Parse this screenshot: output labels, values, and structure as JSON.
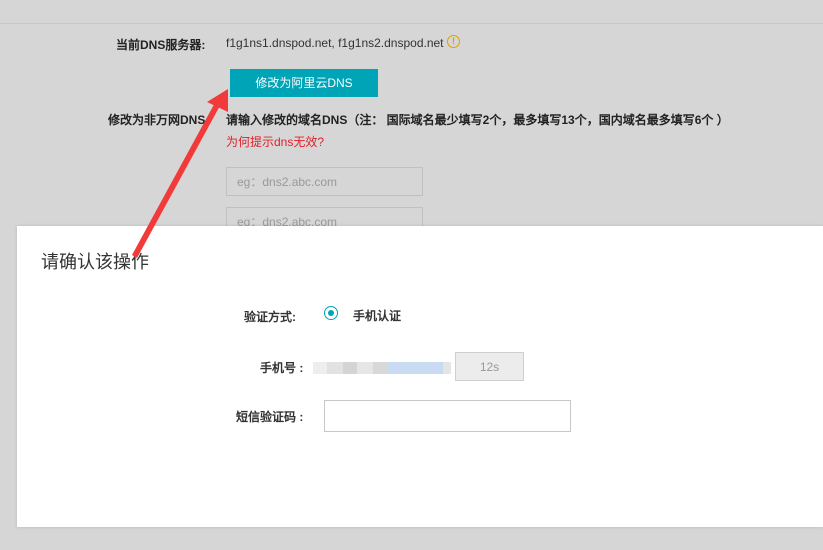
{
  "background_page": {
    "current_dns_label": "当前DNS服务器:",
    "current_dns_value": "f1g1ns1.dnspod.net, f1g1ns2.dnspod.net",
    "change_button_label": "修改为阿里云DNS",
    "non_wanwang_label": "修改为非万网DNS",
    "instruction": "请输入修改的域名DNS（注：  国际域名最少填写2个，最多填写13个，国内域名最多填写6个 ）",
    "hint_link": "为何提示dns无效?",
    "dns_inputs": [
      {
        "placeholder": "eg：dns2.abc.com"
      },
      {
        "placeholder": "eg：dns2.abc.com"
      }
    ],
    "warn_glyph": "!"
  },
  "modal": {
    "title": "请确认该操作",
    "verify_method_label": "验证方式:",
    "verify_method_option": "手机认证",
    "phone_label": "手机号 :",
    "countdown_label": "12s",
    "sms_code_label": "短信验证码 :",
    "sms_code_value": ""
  },
  "colors": {
    "accent": "#00a4b7",
    "link_red": "#e0212c",
    "annotation_arrow": "#f23a3a"
  }
}
